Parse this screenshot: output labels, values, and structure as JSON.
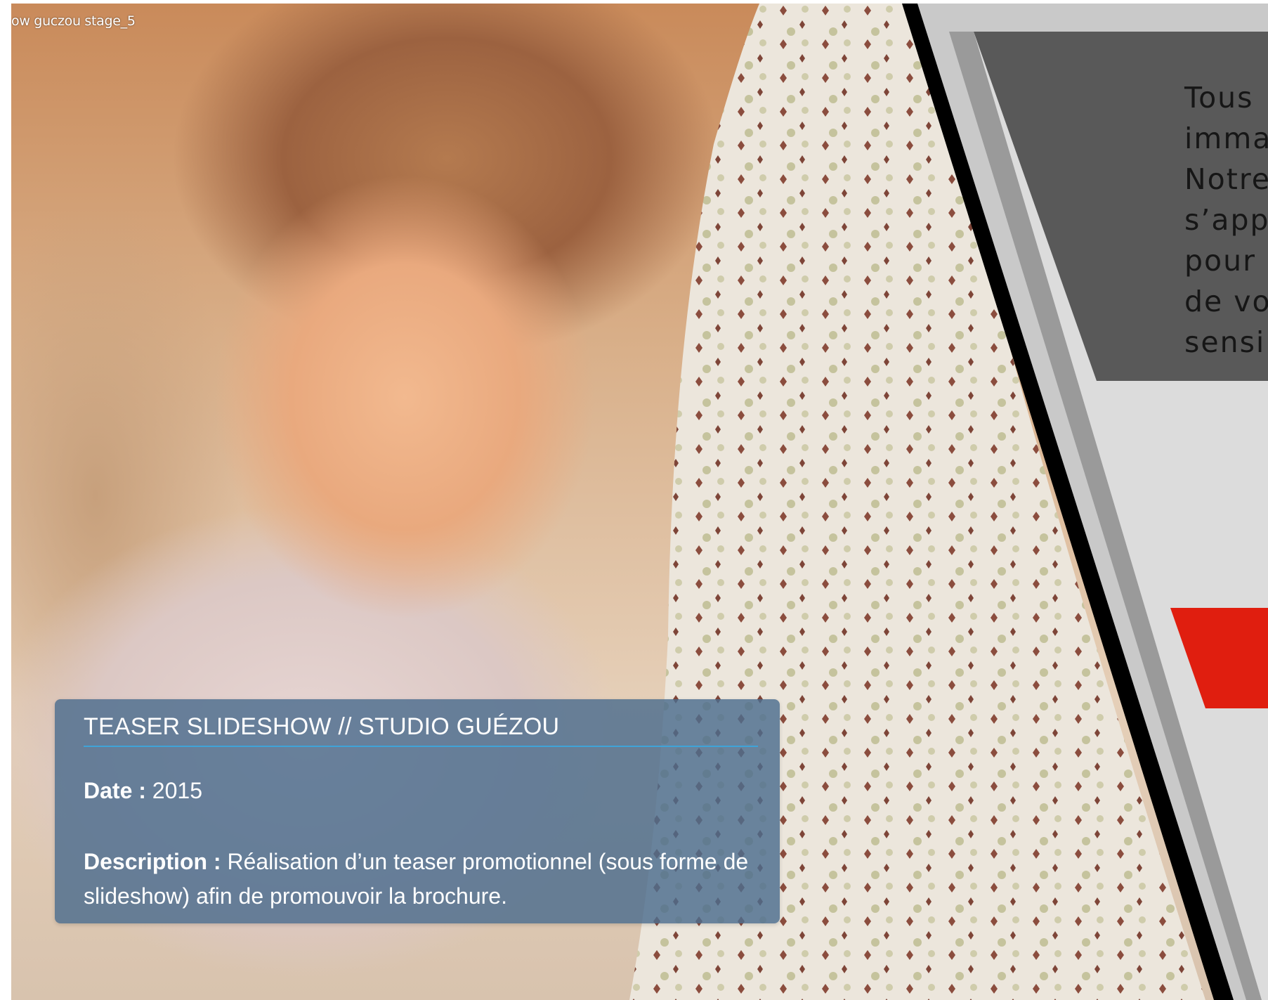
{
  "window": {
    "title": "ow guczou stage_5"
  },
  "right_panel": {
    "text_lines": [
      "Tous",
      "imma",
      "Notre",
      "s’app",
      "pour",
      "de vo",
      "sensi"
    ],
    "colors": {
      "dark_gray": "#595959",
      "light_gray": "#dcdcdc",
      "red": "#e01e0f",
      "stripe": "#000000"
    }
  },
  "info_box": {
    "title": "TEASER SLIDESHOW // STUDIO GUÉZOU",
    "date_label": "Date :",
    "date_value": "2015",
    "description_label": "Description :",
    "description_value": "Réalisation d’un teaser promotionnel (sous forme de slideshow) afin de promouvoir la brochure.",
    "colors": {
      "background": "#4c6c8e",
      "underline": "#3fa3d8"
    }
  },
  "icons": {
    "photo": "child-photo",
    "tree": "birch-tree-trunk"
  }
}
